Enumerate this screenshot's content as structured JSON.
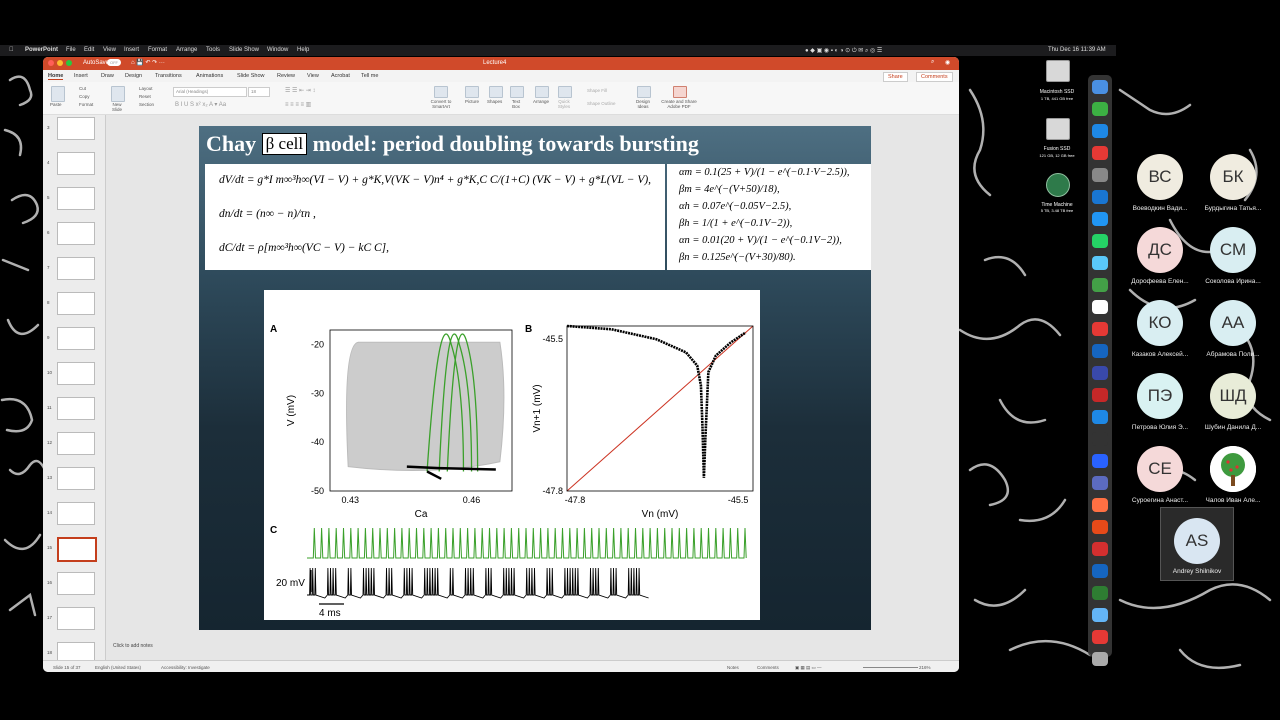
{
  "menubar": {
    "app": "PowerPoint",
    "items": [
      "File",
      "Edit",
      "View",
      "Insert",
      "Format",
      "Arrange",
      "Tools",
      "Slide Show",
      "Window",
      "Help"
    ],
    "clock": "Thu Dec 16 11:39 AM"
  },
  "window": {
    "autosave": "AutoSave",
    "autosave_state": "OFF",
    "doc_title": "Lecture4",
    "tabs": [
      "Home",
      "Insert",
      "Draw",
      "Design",
      "Transitions",
      "Animations",
      "Slide Show",
      "Review",
      "View",
      "Acrobat",
      "Tell me"
    ],
    "share": "Share",
    "comments": "Comments"
  },
  "ribbon": {
    "paste": "Paste",
    "cut": "Cut",
    "copy": "Copy",
    "format": "Format",
    "new_slide": "New Slide",
    "layout": "Layout",
    "reset": "Reset",
    "section": "Section",
    "font_name": "Arial (Headings)",
    "font_size": "18",
    "convert": "Convert to SmartArt",
    "picture": "Picture",
    "shapes": "Shapes",
    "text_box": "Text Box",
    "arrange": "Arrange",
    "quick_styles": "Quick Styles",
    "shape_fill": "Shape Fill",
    "shape_outline": "Shape Outline",
    "design_ideas": "Design Ideas",
    "create_share": "Create and Share Adobe PDF"
  },
  "thumbnails": [
    "3",
    "4",
    "5",
    "6",
    "7",
    "8",
    "9",
    "10",
    "11",
    "12",
    "13",
    "14",
    "15",
    "16",
    "17",
    "18"
  ],
  "slide": {
    "title_part1": "Chay",
    "title_boxed": "β cell",
    "title_part2": "model: period doubling towards bursting",
    "eq_left": [
      "dV/dt = g*I m∞³h∞(VI − V) + g*K,V(VK − V)n⁴ + g*K,C C/(1+C) (VK − V) + g*L(VL − V),",
      "dn/dt = (n∞ − n)/τn ,",
      "dC/dt = ρ[m∞³h∞(VC − V) − kC C],"
    ],
    "eq_right": [
      "αm = 0.1(25 + V)/(1 − e^(−0.1·V−2.5)),",
      "βm = 4e^(−(V+50)/18),",
      "αh = 0.07e^(−0.05V−2.5),",
      "βh = 1/(1 + e^(−0.1V−2)),",
      "αn = 0.01(20 + V)/(1 − e^(−0.1V−2)),",
      "βn = 0.125e^(−(V+30)/80)."
    ]
  },
  "chart_data": [
    {
      "type": "line",
      "panel": "A",
      "xlabel": "Ca",
      "ylabel": "V (mV)",
      "xticks": [
        "0.43",
        "0.46"
      ],
      "yticks": [
        "-20",
        "-30",
        "-40",
        "-50"
      ],
      "xlim": [
        0.425,
        0.47
      ],
      "ylim": [
        -50,
        -17
      ],
      "series": [
        {
          "color": "#aaaaaa",
          "points": [
            [
              0.43,
              -45
            ],
            [
              0.43,
              -20
            ],
            [
              0.468,
              -20
            ],
            [
              0.468,
              -45
            ],
            [
              0.45,
              -47
            ]
          ]
        },
        {
          "color": "#3aa02a",
          "points": [
            [
              0.45,
              -46
            ],
            [
              0.454,
              -22
            ],
            [
              0.457,
              -20
            ],
            [
              0.459,
              -24
            ],
            [
              0.46,
              -46
            ],
            [
              0.457,
              -46
            ],
            [
              0.452,
              -25
            ],
            [
              0.455,
              -21
            ],
            [
              0.458,
              -30
            ],
            [
              0.459,
              -46
            ]
          ]
        },
        {
          "color": "#000000",
          "points": [
            [
              0.444,
              -45
            ],
            [
              0.452,
              -45.3
            ],
            [
              0.461,
              -45.5
            ],
            [
              0.466,
              -45.6
            ]
          ]
        }
      ]
    },
    {
      "type": "scatter",
      "panel": "B",
      "xlabel": "Vn (mV)",
      "ylabel": "Vn+1 (mV)",
      "xticks": [
        "-47.8",
        "-45.5"
      ],
      "yticks": [
        "-45.5",
        "-47.8"
      ],
      "xlim": [
        -47.8,
        -45.3
      ],
      "ylim": [
        -47.8,
        -45.3
      ],
      "series": [
        {
          "color": "#000000",
          "points": [
            [
              -47.8,
              -45.3
            ],
            [
              -47.2,
              -45.35
            ],
            [
              -46.6,
              -45.5
            ],
            [
              -46.2,
              -45.7
            ],
            [
              -46.05,
              -45.9
            ],
            [
              -46.0,
              -46.2
            ],
            [
              -45.98,
              -46.8
            ],
            [
              -45.96,
              -47.6
            ],
            [
              -45.94,
              -47.0
            ],
            [
              -45.9,
              -46.0
            ],
            [
              -45.8,
              -45.75
            ],
            [
              -45.6,
              -45.55
            ],
            [
              -45.4,
              -45.4
            ]
          ]
        },
        {
          "color": "#cc3322",
          "points": [
            [
              -47.8,
              -47.8
            ],
            [
              -45.3,
              -45.3
            ]
          ]
        }
      ]
    },
    {
      "type": "line",
      "panel": "C",
      "scale_v": "20 mV",
      "scale_t": "4 ms",
      "series": [
        {
          "color": "#3aa02a",
          "name": ""
        },
        {
          "color": "#000000",
          "name": ""
        }
      ]
    }
  ],
  "statusbar": {
    "slide_info": "Slide 15 of 37",
    "language": "English (United States)",
    "accessibility": "Accessibility: Investigate",
    "notes": "Notes",
    "comments": "Comments",
    "zoom": "216%",
    "notes_placeholder": "Click to add notes"
  },
  "desktop": {
    "drive1": "Macintosh SSD",
    "drive1_sub": "1 TB, 441 GB free",
    "drive2": "Fusion SSD",
    "drive2_sub": "121 GB, 12 GB free",
    "drive3": "Time Machine",
    "drive3_sub": "5 TB, 3.48 TB free"
  },
  "participants": [
    {
      "initials": "ВС",
      "name": "Воеводкин Вади...",
      "color": "#f0ece0"
    },
    {
      "initials": "БК",
      "name": "Бурдыгина Татья...",
      "color": "#f0ece0"
    },
    {
      "initials": "ДС",
      "name": "Дорофеева Елен...",
      "color": "#f5d9d9"
    },
    {
      "initials": "СМ",
      "name": "Соколова Ирина...",
      "color": "#d9eef2"
    },
    {
      "initials": "КО",
      "name": "Казаков Алексей...",
      "color": "#d9eef2"
    },
    {
      "initials": "АА",
      "name": "Абрамова Поли...",
      "color": "#d9eef2"
    },
    {
      "initials": "ПЭ",
      "name": "Петрова Юлия Э...",
      "color": "#d9f2f2"
    },
    {
      "initials": "ШД",
      "name": "Шубин Данила Д...",
      "color": "#e8ecd8"
    },
    {
      "initials": "СЕ",
      "name": "Суроегина Анаст...",
      "color": "#f5d9d9"
    },
    {
      "initials": "",
      "name": "Чалов Иван Але...",
      "color": "#ffffff"
    }
  ],
  "active_speaker": {
    "initials": "AS",
    "name": "Andrey Shilnikov"
  }
}
